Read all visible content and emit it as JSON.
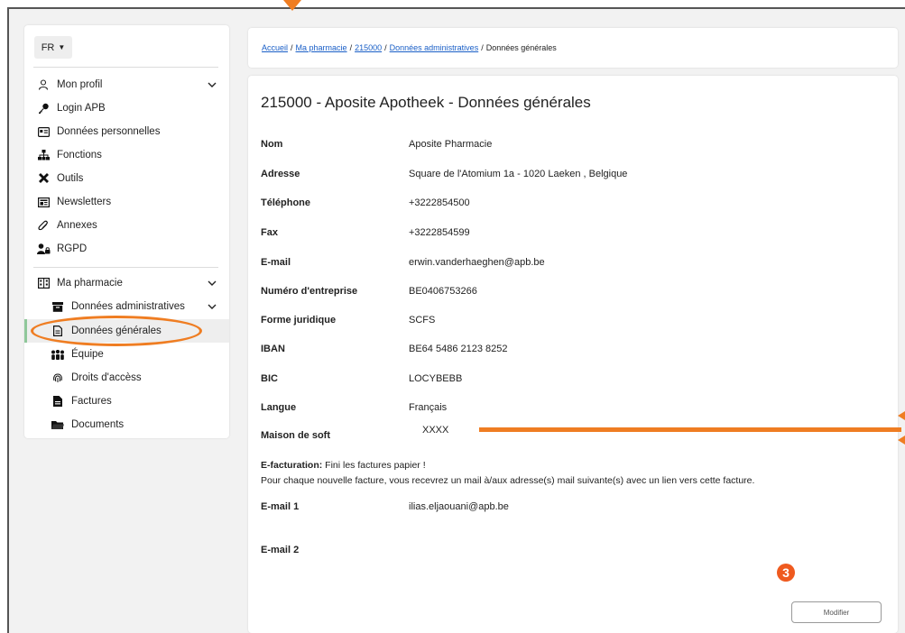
{
  "language": {
    "current": "FR"
  },
  "sidebar": {
    "profile": {
      "label": "Mon profil",
      "items": [
        {
          "label": "Login APB",
          "icon": "key-icon"
        },
        {
          "label": "Données personnelles",
          "icon": "id-card-icon"
        },
        {
          "label": "Fonctions",
          "icon": "sitemap-icon"
        },
        {
          "label": "Outils",
          "icon": "tools-icon"
        },
        {
          "label": "Newsletters",
          "icon": "newspaper-icon"
        },
        {
          "label": "Annexes",
          "icon": "paperclip-icon"
        },
        {
          "label": "RGPD",
          "icon": "user-lock-icon"
        }
      ]
    },
    "pharmacy": {
      "label": "Ma pharmacie",
      "admin": {
        "label": "Données administratives",
        "items": [
          {
            "label": "Données générales",
            "icon": "file-icon",
            "active": true
          },
          {
            "label": "Équipe",
            "icon": "team-icon"
          },
          {
            "label": "Droits d'accèss",
            "icon": "fingerprint-icon"
          },
          {
            "label": "Factures",
            "icon": "invoice-icon"
          }
        ]
      },
      "documents": {
        "label": "Documents",
        "icon": "folder-icon"
      }
    }
  },
  "breadcrumb": {
    "links": [
      "Accueil",
      "Ma pharmacie",
      "215000",
      "Données administratives"
    ],
    "current": "Données générales"
  },
  "main": {
    "title": "215000 - Aposite Apotheek - Données générales",
    "fields": [
      {
        "label": "Nom",
        "value": "Aposite Pharmacie"
      },
      {
        "label": "Adresse",
        "value": "Square de l'Atomium 1a - 1020 Laeken , Belgique"
      },
      {
        "label": "Téléphone",
        "value": "+3222854500"
      },
      {
        "label": "Fax",
        "value": "+3222854599"
      },
      {
        "label": "E-mail",
        "value": "erwin.vanderhaeghen@apb.be"
      },
      {
        "label": "Numéro d'entreprise",
        "value": "BE0406753266"
      },
      {
        "label": "Forme juridique",
        "value": "SCFS"
      },
      {
        "label": "IBAN",
        "value": "BE64 5486 2123 8252"
      },
      {
        "label": "BIC",
        "value": "LOCYBEBB"
      },
      {
        "label": "Langue",
        "value": "Français"
      },
      {
        "label": "Maison de soft",
        "value": "XXXX"
      }
    ],
    "efacturation": {
      "title": "E-facturation:",
      "line1": "Fini les factures papier !",
      "line2": "Pour chaque nouvelle facture, vous recevrez un mail à/aux adresse(s) mail suivante(s) avec un lien vers cette facture."
    },
    "emails": [
      {
        "label": "E-mail 1",
        "value": "ilias.eljaouani@apb.be"
      },
      {
        "label": "E-mail 2",
        "value": ""
      }
    ],
    "step_badge": "❸",
    "modify_button": "Modifier"
  },
  "colors": {
    "accent": "#ef7d22",
    "link": "#1a5fc7",
    "active_bar": "#8fc79a",
    "badge": "#ef5a1f"
  }
}
